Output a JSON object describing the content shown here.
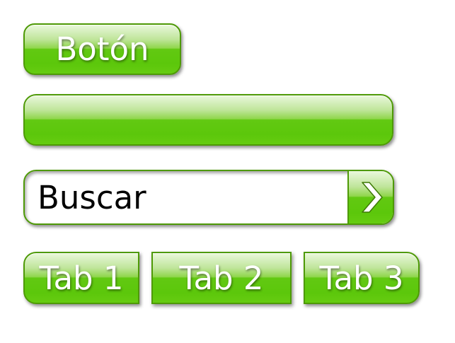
{
  "button": {
    "label": "Botón"
  },
  "bar": {},
  "search": {
    "placeholder": "Buscar",
    "go_icon": "chevron-right-icon"
  },
  "tabs": [
    {
      "label": "Tab 1"
    },
    {
      "label": "Tab 2"
    },
    {
      "label": "Tab 3"
    }
  ],
  "colors": {
    "accent_green": "#5cc70b",
    "border_green": "#4e9a06",
    "text_white": "#ffffff"
  }
}
